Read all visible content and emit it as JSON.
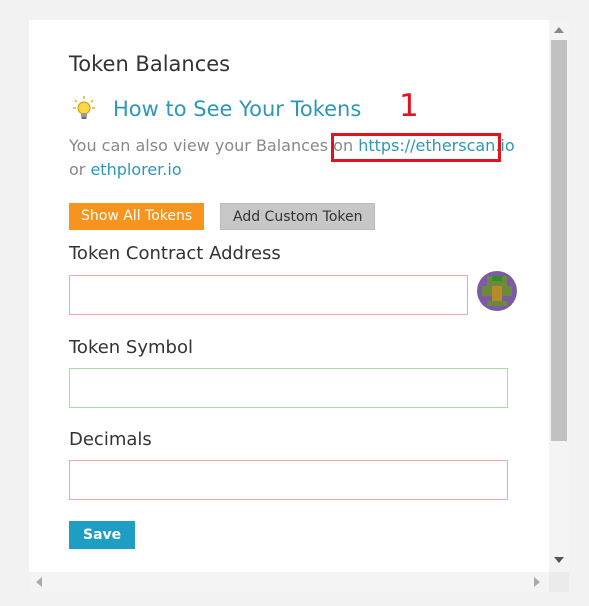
{
  "panel": {
    "title": "Token Balances",
    "howto": {
      "label": "How to See Your Tokens",
      "icon": "lightbulb-icon"
    },
    "info": {
      "prefix": "You can also view your Balances on ",
      "link1": "https://etherscan.io",
      "middle": " or ",
      "link2": "ethplorer.io"
    },
    "annotation": {
      "number": "1",
      "color": "#e0141e"
    },
    "buttons": {
      "show_all": "Show All Tokens",
      "add_custom": "Add Custom Token",
      "save": "Save"
    },
    "fields": {
      "contract_address": {
        "label": "Token Contract Address",
        "value": ""
      },
      "symbol": {
        "label": "Token Symbol",
        "value": ""
      },
      "decimals": {
        "label": "Decimals",
        "value": ""
      }
    }
  },
  "colors": {
    "accent": "#2d97b8",
    "orange": "#f7941d",
    "save": "#1f9ec3",
    "invalid": "#f3a6a6",
    "valid": "#a9dca9"
  }
}
